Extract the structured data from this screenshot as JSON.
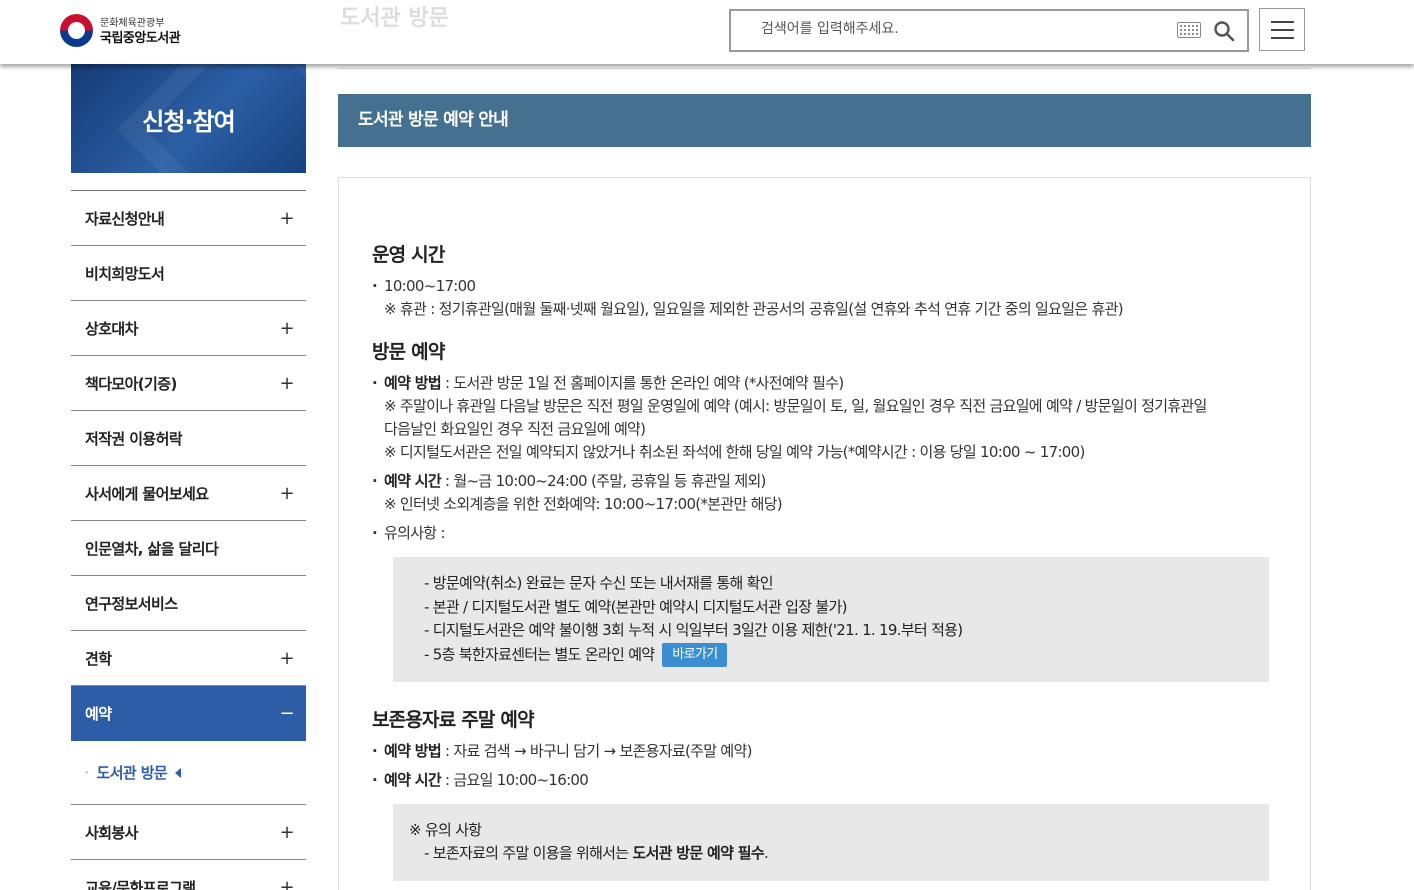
{
  "header": {
    "ministry": "문화체육관광부",
    "library_name": "국립중앙도서관",
    "ghost_title": "도서관 방문",
    "search_placeholder": "검색어를 입력해주세요."
  },
  "sidebar": {
    "title": "신청·참여",
    "items": [
      {
        "label": "자료신청안내",
        "sign": "+"
      },
      {
        "label": "비치희망도서",
        "sign": ""
      },
      {
        "label": "상호대차",
        "sign": "+"
      },
      {
        "label": "책다모아(기증)",
        "sign": "+"
      },
      {
        "label": "저작권 이용허락",
        "sign": ""
      },
      {
        "label": "사서에게 물어보세요",
        "sign": "+"
      },
      {
        "label": "인문열차, 삶을 달리다",
        "sign": ""
      },
      {
        "label": "연구정보서비스",
        "sign": ""
      },
      {
        "label": "견학",
        "sign": "+"
      },
      {
        "label": "예약",
        "sign": "−"
      },
      {
        "label": "사회봉사",
        "sign": "+"
      },
      {
        "label": "교육/문화프로그램",
        "sign": "+"
      }
    ],
    "sub_item": "도서관 방문"
  },
  "content": {
    "section_title": "도서관 방문 예약 안내",
    "hours": {
      "heading": "운영 시간",
      "time": "10:00~17:00",
      "note": "※ 휴관 : 정기휴관일(매월 둘째·넷째 월요일), 일요일을 제외한 관공서의 공휴일(설 연휴와 추석 연휴 기간 중의 일요일은 휴관)"
    },
    "visit": {
      "heading": "방문 예약",
      "method_label": "예약 방법",
      "method_text": " : 도서관 방문 1일 전 홈페이지를 통한 온라인 예약 (*사전예약 필수)",
      "method_note1": "※ 주말이나 휴관일 다음날 방문은 직전 평일 운영일에 예약 (예시: 방문일이 토, 일, 월요일인 경우 직전 금요일에 예약 / 방문일이 정기휴관일",
      "method_note1b": "다음날인 화요일인 경우 직전 금요일에 예약)",
      "method_note2": "※ 디지털도서관은 전일 예약되지 않았거나 취소된 좌석에 한해 당일 예약 가능(*예약시간 : 이용 당일 10:00 ~ 17:00)",
      "time_label": "예약 시간",
      "time_text": " : 월~금 10:00~24:00 (주말, 공휴일 등 휴관일 제외)",
      "time_note": "※ 인터넷 소외계층을 위한 전화예약: 10:00~17:00(*본관만 해당)",
      "caution_label": "유의사항 :",
      "cautions": [
        "- 방문예약(취소) 완료는 문자 수신 또는 내서재를 통해 확인",
        "- 본관 / 디지털도서관 별도 예약(본관만 예약시 디지털도서관 입장 불가)",
        "- 디지털도서관은 예약 불이행 3회 누적 시 익일부터 3일간 이용 제한('21. 1. 19.부터 적용)",
        "- 5층 북한자료센터는 별도 온라인 예약"
      ],
      "go_button": "바로가기"
    },
    "preserve": {
      "heading": "보존용자료 주말 예약",
      "method_label": "예약 방법",
      "method_text": " : 자료 검색 → 바구니 담기 → 보존용자료(주말 예약)",
      "time_label": "예약 시간",
      "time_text": " : 금요일 10:00~16:00",
      "note_title": "※ 유의 사항",
      "note_prefix": "- 보존자료의 주말 이용을 위해서는 ",
      "note_bold": "도서관 방문 예약 필수",
      "note_suffix": "."
    }
  }
}
